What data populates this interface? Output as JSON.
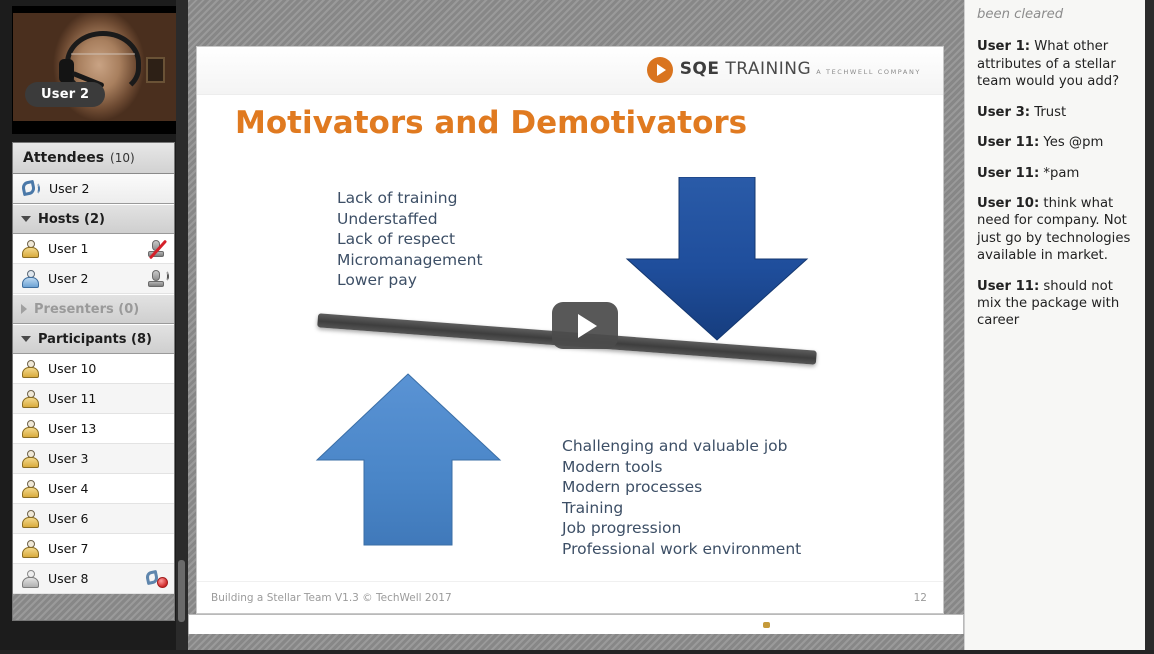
{
  "video": {
    "participant_label": "User 2"
  },
  "attendees": {
    "header_title": "Attendees",
    "header_count": "(10)",
    "phone_row": {
      "label": "User 2",
      "icon": "phone-icon"
    },
    "groups": [
      {
        "name": "Hosts (2)",
        "expanded": true,
        "members": [
          {
            "label": "User 1",
            "avatar": "avatar-gold",
            "status_icon": "microphone-muted-icon"
          },
          {
            "label": "User 2",
            "avatar": "avatar-blue",
            "status_icon": "microphone-active-icon"
          }
        ]
      },
      {
        "name": "Presenters (0)",
        "expanded": false,
        "members": []
      },
      {
        "name": "Participants (8)",
        "expanded": true,
        "members": [
          {
            "label": "User 10",
            "avatar": "avatar-gold",
            "status_icon": ""
          },
          {
            "label": "User 11",
            "avatar": "avatar-gold",
            "status_icon": ""
          },
          {
            "label": "User 13",
            "avatar": "avatar-gold",
            "status_icon": ""
          },
          {
            "label": "User 3",
            "avatar": "avatar-gold",
            "status_icon": ""
          },
          {
            "label": "User 4",
            "avatar": "avatar-gold",
            "status_icon": ""
          },
          {
            "label": "User 6",
            "avatar": "avatar-gold",
            "status_icon": ""
          },
          {
            "label": "User 7",
            "avatar": "avatar-gold",
            "status_icon": ""
          },
          {
            "label": "User 8",
            "avatar": "avatar-gray",
            "status_icon": "phone-denied-icon"
          }
        ]
      }
    ]
  },
  "slide": {
    "logo": {
      "brand": "SQE",
      "brand_rest": " TRAINING",
      "tagline": "A TECHWELL COMPANY"
    },
    "title": "Motivators and Demotivators",
    "demotivators": "Lack of training\nUnderstaffed\nLack of respect\nMicromanagement\nLower pay",
    "motivators": "Challenging and valuable job\nModern tools\nModern processes\nTraining\nJob progression\nProfessional work environment",
    "footer_text": "Building a Stellar Team V1.3 © TechWell 2017",
    "page_number": "12",
    "colors": {
      "title_orange": "#e07a20",
      "body_blue": "#3d4f66",
      "arrow_down_blue": "#1f4e9c",
      "arrow_up_blue": "#4a86c8",
      "plank_gray": "#3e3e3e",
      "logo_orange": "#d9741f"
    }
  },
  "player": {
    "play_button": "play-icon"
  },
  "chat": {
    "messages": [
      {
        "who": "",
        "text": "been cleared",
        "partial": true
      },
      {
        "who": "User 1:",
        "text": " What other attributes of a stellar team would you add?"
      },
      {
        "who": "User 3:",
        "text": " Trust"
      },
      {
        "who": "User 11:",
        "text": " Yes @pm"
      },
      {
        "who": "User 11:",
        "text": " *pam"
      },
      {
        "who": "User 10:",
        "text": " think what need for company. Not just go by technologies available in market."
      },
      {
        "who": "User 11:",
        "text": " should  not mix the package with career"
      }
    ]
  }
}
